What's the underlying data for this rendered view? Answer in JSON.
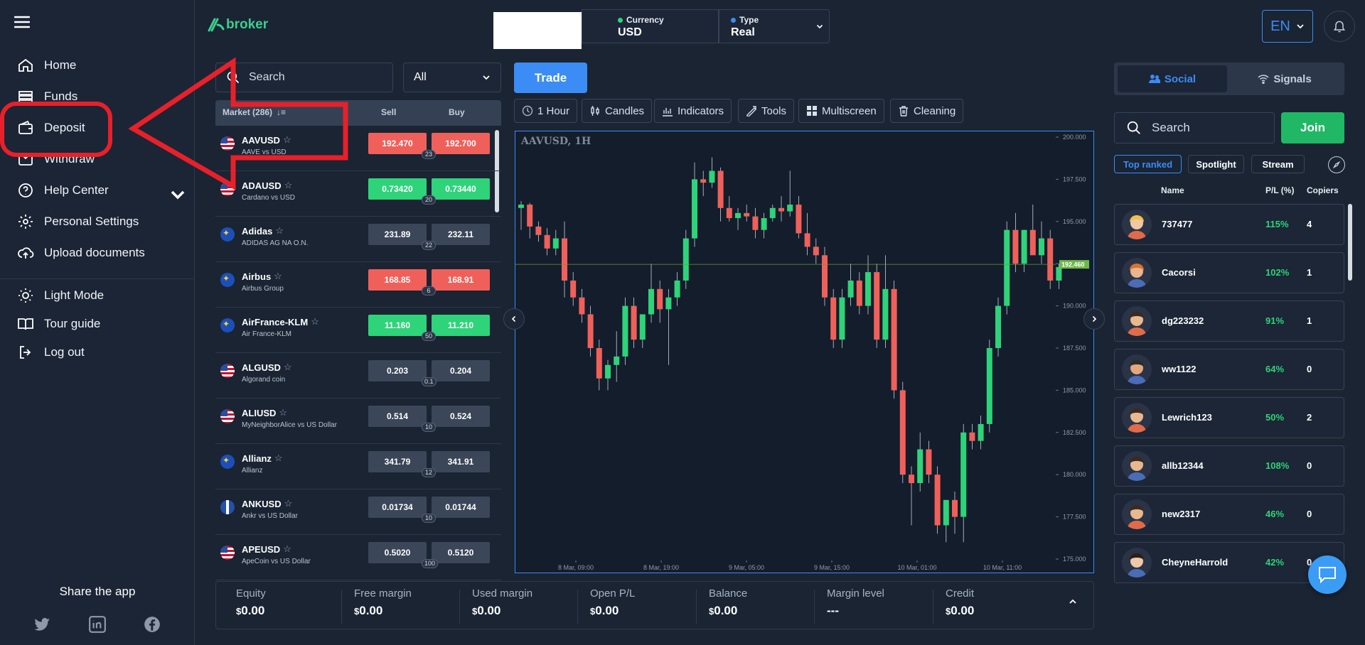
{
  "sidebar": {
    "items": [
      {
        "label": "Home",
        "icon": "home-icon"
      },
      {
        "label": "Funds",
        "icon": "funds-icon"
      },
      {
        "label": "Deposit",
        "icon": "wallet-icon"
      },
      {
        "label": "Withdraw",
        "icon": "withdraw-icon"
      },
      {
        "label": "Help Center",
        "icon": "help-icon"
      },
      {
        "label": "Personal Settings",
        "icon": "gear-icon"
      },
      {
        "label": "Upload documents",
        "icon": "upload-icon"
      }
    ],
    "secondary": [
      {
        "label": "Light Mode",
        "icon": "sun-icon"
      },
      {
        "label": "Tour guide",
        "icon": "book-icon"
      },
      {
        "label": "Log out",
        "icon": "logout-icon"
      }
    ],
    "share_label": "Share the app",
    "social": [
      "twitter-icon",
      "linkedin-icon",
      "facebook-icon"
    ]
  },
  "header": {
    "logo_text": "broker",
    "currency_label": "Currency",
    "currency_value": "USD",
    "type_label": "Type",
    "type_value": "Real",
    "language": "EN"
  },
  "market": {
    "search_placeholder": "Search",
    "filter_value": "All",
    "col_market": "Market (286)",
    "col_sell": "Sell",
    "col_buy": "Buy",
    "rows": [
      {
        "symbol": "AAVUSD",
        "desc": "AAVE vs USD",
        "sell": "192.470",
        "buy": "192.700",
        "spread": "23",
        "color": "red",
        "flag": "us"
      },
      {
        "symbol": "ADAUSD",
        "desc": "Cardano vs USD",
        "sell": "0.73420",
        "buy": "0.73440",
        "spread": "20",
        "color": "green",
        "flag": "us"
      },
      {
        "symbol": "Adidas",
        "desc": "ADIDAS AG NA O.N.",
        "sell": "231.89",
        "buy": "232.11",
        "spread": "22",
        "color": "gray",
        "flag": "eu"
      },
      {
        "symbol": "Airbus",
        "desc": "Airbus Group",
        "sell": "168.85",
        "buy": "168.91",
        "spread": "6",
        "color": "red",
        "flag": "eu"
      },
      {
        "symbol": "AirFrance-KLM",
        "desc": "Air France-KLM",
        "sell": "11.160",
        "buy": "11.210",
        "spread": "50",
        "color": "green",
        "flag": "eu"
      },
      {
        "symbol": "ALGUSD",
        "desc": "Algorand coin",
        "sell": "0.203",
        "buy": "0.204",
        "spread": "0.1",
        "color": "gray",
        "flag": "us"
      },
      {
        "symbol": "ALIUSD",
        "desc": "MyNeighborAlice vs US Dollar",
        "sell": "0.514",
        "buy": "0.524",
        "spread": "10",
        "color": "gray",
        "flag": "us"
      },
      {
        "symbol": "Allianz",
        "desc": "Allianz",
        "sell": "341.79",
        "buy": "341.91",
        "spread": "12",
        "color": "gray",
        "flag": "eu"
      },
      {
        "symbol": "ANKUSD",
        "desc": "Ankr vs US Dollar",
        "sell": "0.01734",
        "buy": "0.01744",
        "spread": "10",
        "color": "gray",
        "flag": "gb"
      },
      {
        "symbol": "APEUSD",
        "desc": "ApeCoin vs US Dollar",
        "sell": "0.5020",
        "buy": "0.5120",
        "spread": "100",
        "color": "gray",
        "flag": "us"
      }
    ]
  },
  "chart_toolbar": {
    "trade": "Trade",
    "interval": "1 Hour",
    "style": "Candles",
    "indicators": "Indicators",
    "tools": "Tools",
    "multiscreen": "Multiscreen",
    "cleaning": "Cleaning"
  },
  "chart_data": {
    "type": "candlestick",
    "title": "AAVUSD, 1H",
    "x_ticks": [
      "8 Mar, 09:00",
      "8 Mar, 19:00",
      "9 Mar, 05:00",
      "9 Mar, 15:00",
      "10 Mar, 01:00",
      "10 Mar, 11:00"
    ],
    "y_ticks": [
      "200.000",
      "197.500",
      "195.000",
      "192.500",
      "190.000",
      "187.500",
      "185.000",
      "182.500",
      "180.000",
      "177.500",
      "175.000"
    ],
    "ylim": [
      175.0,
      200.0
    ],
    "current_price": "192.460",
    "up_color": "#2ed37a",
    "down_color": "#f0605a",
    "candles": [
      [
        195.8,
        196.2,
        194.5,
        196.0
      ],
      [
        196.0,
        196.1,
        194.0,
        194.7
      ],
      [
        194.7,
        195.0,
        193.8,
        194.2
      ],
      [
        194.2,
        194.6,
        193.0,
        193.4
      ],
      [
        193.4,
        194.5,
        193.0,
        194.0
      ],
      [
        194.0,
        195.0,
        190.5,
        191.5
      ],
      [
        191.5,
        192.0,
        190.0,
        190.5
      ],
      [
        190.5,
        191.0,
        189.0,
        189.5
      ],
      [
        189.5,
        190.0,
        187.0,
        187.5
      ],
      [
        187.5,
        188.0,
        185.0,
        185.7
      ],
      [
        185.7,
        186.8,
        185.0,
        186.5
      ],
      [
        186.5,
        188.5,
        185.5,
        187.0
      ],
      [
        187.0,
        190.5,
        186.5,
        190.0
      ],
      [
        190.0,
        190.5,
        187.5,
        188.0
      ],
      [
        188.0,
        189.5,
        187.5,
        189.5
      ],
      [
        189.5,
        192.5,
        189.0,
        191.0
      ],
      [
        191.0,
        191.5,
        189.0,
        189.8
      ],
      [
        189.8,
        191.0,
        186.5,
        190.5
      ],
      [
        190.5,
        192.0,
        190.0,
        191.5
      ],
      [
        191.5,
        194.5,
        191.0,
        194.0
      ],
      [
        194.0,
        198.5,
        193.5,
        197.5
      ],
      [
        197.5,
        198.0,
        196.5,
        197.3
      ],
      [
        197.3,
        198.8,
        197.0,
        198.0
      ],
      [
        198.0,
        198.2,
        195.0,
        195.8
      ],
      [
        195.8,
        196.5,
        195.0,
        195.2
      ],
      [
        195.2,
        195.8,
        194.5,
        195.5
      ],
      [
        195.5,
        196.0,
        195.0,
        195.3
      ],
      [
        195.3,
        195.8,
        194.0,
        194.5
      ],
      [
        194.5,
        195.5,
        194.0,
        195.2
      ],
      [
        195.2,
        196.0,
        195.0,
        195.8
      ],
      [
        195.8,
        196.5,
        195.0,
        195.6
      ],
      [
        195.6,
        198.0,
        195.3,
        196.0
      ],
      [
        196.0,
        196.5,
        194.0,
        194.3
      ],
      [
        194.3,
        195.5,
        193.0,
        193.5
      ],
      [
        193.5,
        194.0,
        192.5,
        193.0
      ],
      [
        193.0,
        193.5,
        190.0,
        190.5
      ],
      [
        190.5,
        191.0,
        187.5,
        188.0
      ],
      [
        188.0,
        191.0,
        187.5,
        190.5
      ],
      [
        190.5,
        192.5,
        190.0,
        191.5
      ],
      [
        191.5,
        192.0,
        189.5,
        190.0
      ],
      [
        190.0,
        193.0,
        189.5,
        192.0
      ],
      [
        192.0,
        192.5,
        187.5,
        188.0
      ],
      [
        188.0,
        193.0,
        187.5,
        191.0
      ],
      [
        191.0,
        191.5,
        184.5,
        185.0
      ],
      [
        185.0,
        185.5,
        179.5,
        180.0
      ],
      [
        180.0,
        180.5,
        177.0,
        179.5
      ],
      [
        179.5,
        182.5,
        179.0,
        181.5
      ],
      [
        181.5,
        182.0,
        179.5,
        180.0
      ],
      [
        180.0,
        180.5,
        176.5,
        177.0
      ],
      [
        177.0,
        178.5,
        176.0,
        178.5
      ],
      [
        178.5,
        179.0,
        176.5,
        177.5
      ],
      [
        177.5,
        183.0,
        176.0,
        182.5
      ],
      [
        182.5,
        183.0,
        181.5,
        182.0
      ],
      [
        182.0,
        183.5,
        181.5,
        183.0
      ],
      [
        183.0,
        188.0,
        182.5,
        187.5
      ],
      [
        187.5,
        190.5,
        187.0,
        190.0
      ],
      [
        190.0,
        195.0,
        189.5,
        194.5
      ],
      [
        194.5,
        195.5,
        192.0,
        192.5
      ],
      [
        192.5,
        194.5,
        192.0,
        194.5
      ],
      [
        194.5,
        196.0,
        193.5,
        193.0
      ],
      [
        193.0,
        195.0,
        192.5,
        194.0
      ],
      [
        194.0,
        194.5,
        191.0,
        191.5
      ],
      [
        191.5,
        192.5,
        191.0,
        192.3
      ]
    ]
  },
  "account": {
    "items": [
      {
        "label": "Equity",
        "value": "0.00",
        "currency": "$"
      },
      {
        "label": "Free margin",
        "value": "0.00",
        "currency": "$"
      },
      {
        "label": "Used margin",
        "value": "0.00",
        "currency": "$"
      },
      {
        "label": "Open P/L",
        "value": "0.00",
        "currency": "$"
      },
      {
        "label": "Balance",
        "value": "0.00",
        "currency": "$"
      },
      {
        "label": "Margin level",
        "value": "---",
        "currency": ""
      },
      {
        "label": "Credit",
        "value": "0.00",
        "currency": "$"
      }
    ]
  },
  "social": {
    "tab_social": "Social",
    "tab_signals": "Signals",
    "search_placeholder": "Search",
    "join": "Join",
    "filters": [
      "Top ranked",
      "Spotlight",
      "Stream"
    ],
    "col_name": "Name",
    "col_pl": "P/L (%)",
    "col_copiers": "Copiers",
    "traders": [
      {
        "name": "737477",
        "pl": "115%",
        "copiers": "4"
      },
      {
        "name": "Cacorsi",
        "pl": "102%",
        "copiers": "1"
      },
      {
        "name": "dg223232",
        "pl": "91%",
        "copiers": "1"
      },
      {
        "name": "ww1122",
        "pl": "64%",
        "copiers": "0"
      },
      {
        "name": "Lewrich123",
        "pl": "50%",
        "copiers": "2"
      },
      {
        "name": "allb12344",
        "pl": "108%",
        "copiers": "0"
      },
      {
        "name": "new2317",
        "pl": "46%",
        "copiers": "0"
      },
      {
        "name": "CheyneHarrold",
        "pl": "42%",
        "copiers": "0"
      }
    ]
  },
  "colors": {
    "accent": "#3b8cf5",
    "annotation": "#e8202a",
    "positive": "#2ed37a",
    "negative": "#f0605a"
  }
}
